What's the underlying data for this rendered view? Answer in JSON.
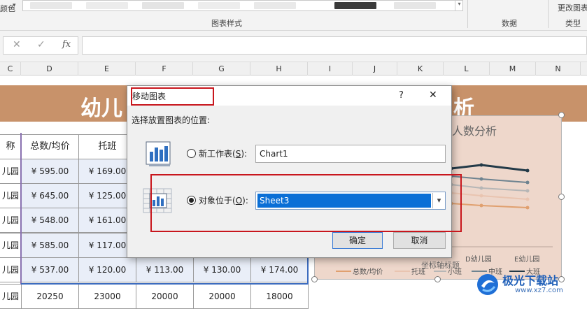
{
  "ribbon": {
    "partial_label": "颜色",
    "chart_styles_label": "图表样式",
    "data_label": "数据",
    "type_label": "类型",
    "change_type_label": "更改图表类型"
  },
  "formula_bar": {
    "cancel_glyph": "✕",
    "confirm_glyph": "✓",
    "fx_glyph": "fx",
    "value": ""
  },
  "columns": [
    "C",
    "D",
    "E",
    "F",
    "G",
    "H",
    "I",
    "J",
    "K",
    "L",
    "M",
    "N"
  ],
  "sheet": {
    "banner_left": "幼儿",
    "banner_right": "析",
    "headers": [
      "称",
      "总数/均价",
      "托班"
    ],
    "rows": [
      {
        "name": "儿园",
        "total": "¥ 595.00",
        "tuo": "¥ 169.00"
      },
      {
        "name": "儿园",
        "total": "¥ 645.00",
        "tuo": "¥ 125.00"
      },
      {
        "name": "儿园",
        "total": "¥ 548.00",
        "tuo": "¥ 161.00"
      },
      {
        "name": "儿园",
        "total": "¥ 585.00",
        "tuo": "¥ 117.00"
      },
      {
        "name": "儿园",
        "total": "¥ 537.00",
        "tuo": "¥ 120.00",
        "f": "¥ 113.00",
        "g": "¥ 130.00",
        "h": "¥ 174.00"
      }
    ],
    "last_row": {
      "name": "儿园",
      "d": "20250",
      "e": "23000",
      "f": "20000",
      "g": "20000",
      "h": "18000"
    }
  },
  "chart": {
    "title": "人数分析",
    "x_labels": [
      "D幼儿园",
      "E幼儿园"
    ],
    "axis_title": "坐标轴标题",
    "legend": [
      "总数/均价",
      "托班",
      "小班",
      "中班",
      "大班"
    ],
    "colors": {
      "total": "#e0a06f",
      "tuo": "#e9c4b0",
      "xiao": "#b6b6b6",
      "zhong": "#6e8390",
      "da": "#233a48"
    }
  },
  "dialog": {
    "title": "移动图表",
    "help": "?",
    "close": "✕",
    "prompt": "选择放置图表的位置:",
    "option_new_label": "新工作表(",
    "option_new_key": "S",
    "option_new_suffix": "):",
    "option_new_value": "Chart1",
    "option_obj_label": "对象位于(",
    "option_obj_key": "O",
    "option_obj_suffix": "):",
    "option_obj_value": "Sheet3",
    "ok": "确定",
    "cancel": "取消"
  },
  "watermark": {
    "text": "极光下载站",
    "url": "www.xz7.com"
  }
}
